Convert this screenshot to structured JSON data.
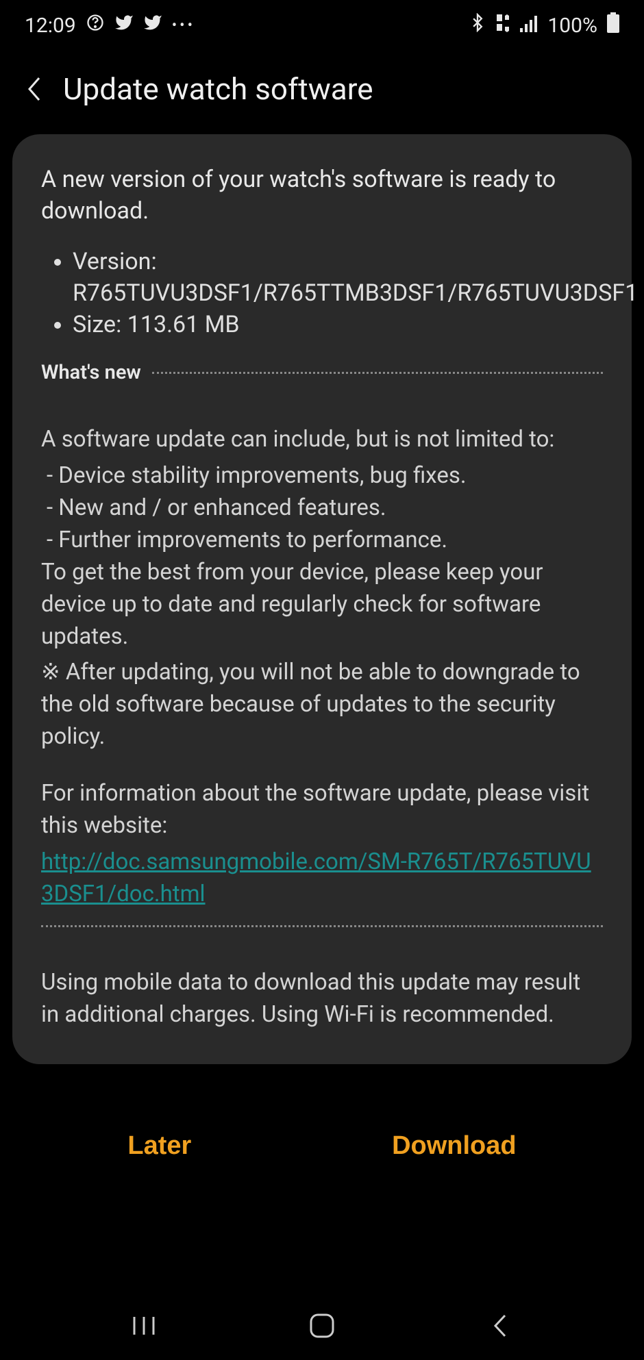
{
  "status_bar": {
    "time": "12:09",
    "battery_text": "100%"
  },
  "header": {
    "title": "Update watch software"
  },
  "card": {
    "intro": "A new version of your watch's software is ready to download.",
    "version_label": "Version: R765TUVU3DSF1/R765TTMB3DSF1/R765TUVU3DSF1",
    "size_label": "Size: 113.61 MB",
    "whats_new_label": "What's new",
    "body_line1": "A software update can include, but is not limited to:",
    "body_bullet1": " - Device stability improvements, bug fixes.",
    "body_bullet2": " - New and / or enhanced features.",
    "body_bullet3": " - Further improvements to performance.",
    "body_line2": "To get the best from your device, please keep your device up to date and regularly check for software updates.",
    "body_note": "※ After updating, you will not be able to downgrade to the old software because of updates to the security policy.",
    "info_text": "For information about the software update, please visit this website:",
    "info_link": "http://doc.samsungmobile.com/SM-R765T/R765TUVU3DSF1/doc.html",
    "data_warning": "Using mobile data to download this update may result in additional charges. Using Wi-Fi is recommended."
  },
  "buttons": {
    "later": "Later",
    "download": "Download"
  }
}
